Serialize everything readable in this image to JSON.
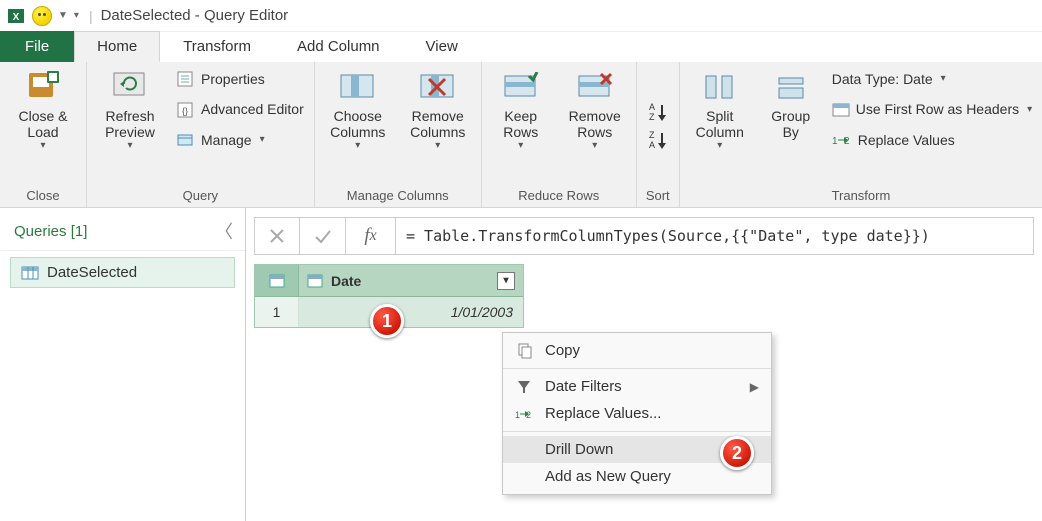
{
  "title": "DateSelected - Query Editor",
  "tabs": {
    "file": "File",
    "home": "Home",
    "transform": "Transform",
    "addcolumn": "Add Column",
    "view": "View"
  },
  "ribbon": {
    "close_group": "Close",
    "close_load": "Close & Load",
    "query_group": "Query",
    "refresh_preview": "Refresh Preview",
    "properties": "Properties",
    "advanced_editor": "Advanced Editor",
    "manage": "Manage",
    "manage_columns_group": "Manage Columns",
    "choose_columns": "Choose Columns",
    "remove_columns": "Remove Columns",
    "reduce_rows_group": "Reduce Rows",
    "keep_rows": "Keep Rows",
    "remove_rows": "Remove Rows",
    "sort_group": "Sort",
    "transform_group": "Transform",
    "split_column": "Split Column",
    "group_by": "Group By",
    "data_type": "Data Type: Date",
    "first_row_headers": "Use First Row as Headers",
    "replace_values": "Replace Values"
  },
  "queries": {
    "header": "Queries [1]",
    "items": [
      "DateSelected"
    ]
  },
  "formula": "= Table.TransformColumnTypes(Source,{{\"Date\", type date}})",
  "table": {
    "columns": [
      "Date"
    ],
    "rows": [
      {
        "num": "1",
        "date": "1/01/2003"
      }
    ]
  },
  "context_menu": {
    "copy": "Copy",
    "date_filters": "Date Filters",
    "replace_values": "Replace Values...",
    "drill_down": "Drill Down",
    "add_new_query": "Add as New Query"
  },
  "callouts": {
    "one": "1",
    "two": "2"
  }
}
